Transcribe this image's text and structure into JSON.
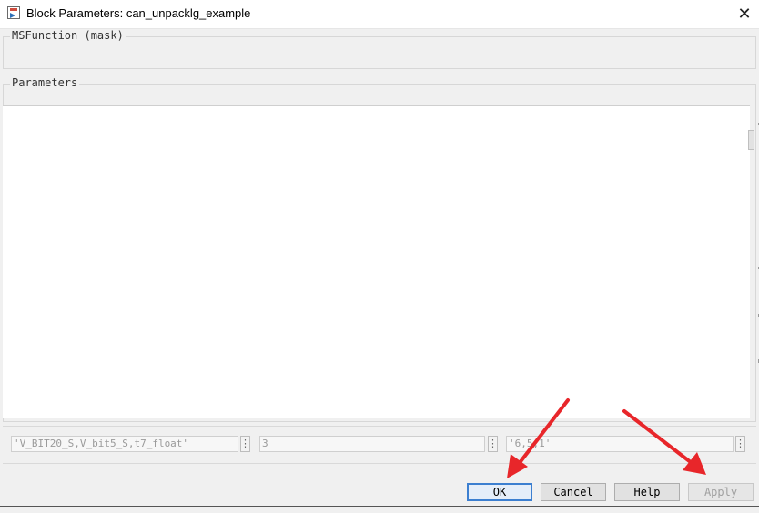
{
  "window": {
    "title": "Block Parameters: can_unpacklg_example",
    "close_glyph": "✕"
  },
  "groups": {
    "function_label": "MSFunction (mask)",
    "parameters_label": "Parameters"
  },
  "inputs": [
    {
      "value": "'V_BIT20_S,V_bit5_S,t7_float'",
      "browse": "⋮"
    },
    {
      "value": "3",
      "browse": "⋮"
    },
    {
      "value": "'6,5,1'",
      "browse": "⋮"
    }
  ],
  "buttons": {
    "ok": "OK",
    "cancel": "Cancel",
    "help": "Help",
    "apply": "Apply"
  },
  "annotation_color": "#e8262a"
}
